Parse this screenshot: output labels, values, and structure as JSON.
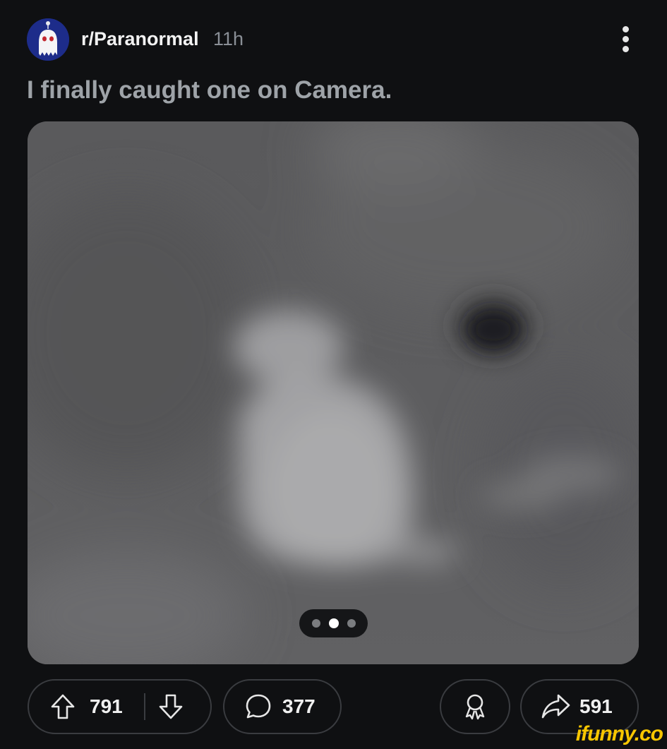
{
  "post": {
    "subreddit": "r/Paranormal",
    "age": "11h",
    "title": "I finally caught one on Camera."
  },
  "media": {
    "page_count": 3,
    "active_page": 2
  },
  "actions": {
    "upvotes": "791",
    "comments": "377",
    "shares": "591"
  },
  "icons": {
    "avatar": "ghost-avatar-icon",
    "more": "more-vertical-icon",
    "upvote": "arrow-up-icon",
    "downvote": "arrow-down-icon",
    "comment": "speech-bubble-icon",
    "award": "award-icon",
    "share": "share-arrow-icon"
  },
  "watermark": "ifunny.co",
  "colors": {
    "background": "#0f1012",
    "title": "#9ea3a8",
    "border": "#3a3c40",
    "watermark": "#f7c600"
  }
}
